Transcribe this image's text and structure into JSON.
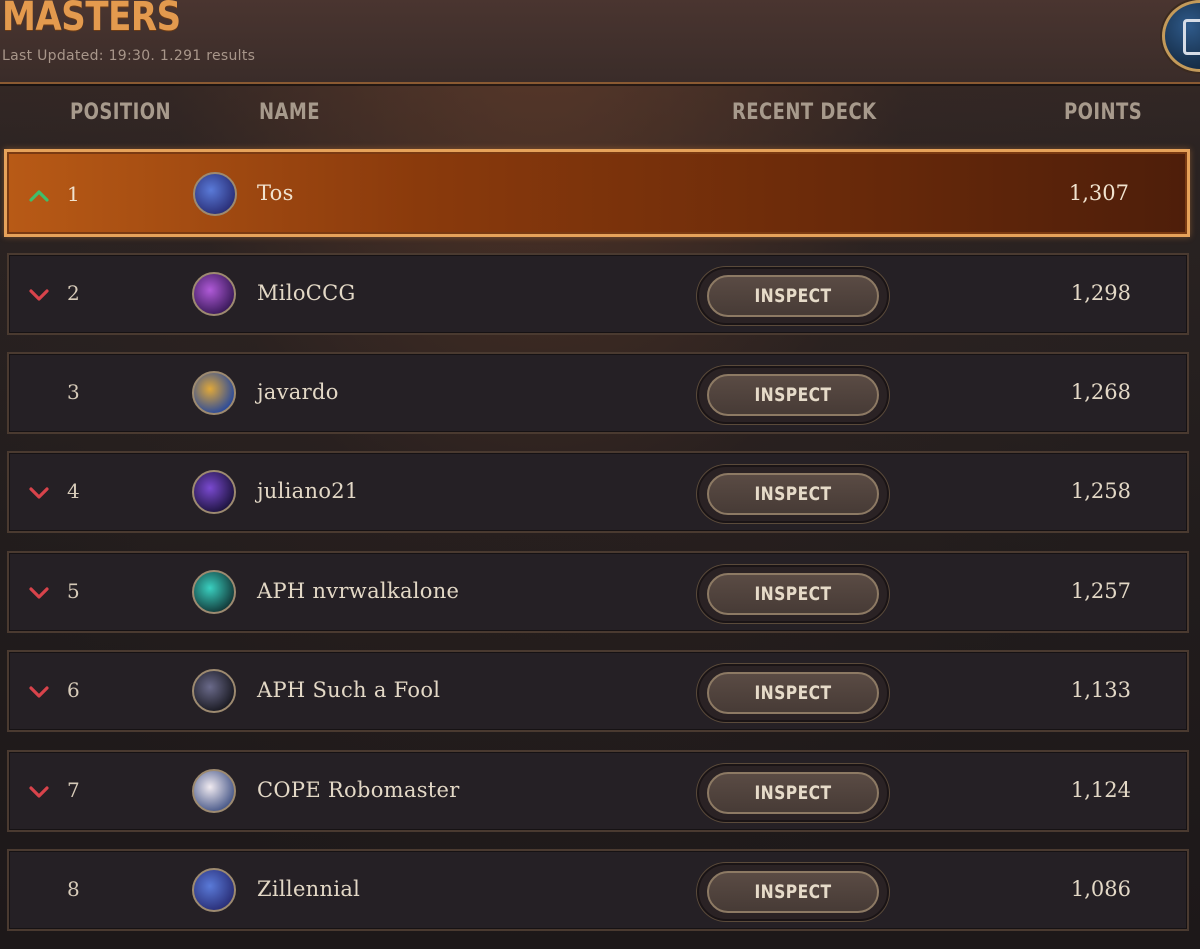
{
  "header": {
    "title": "MASTERS",
    "subtitle": "Last Updated: 19:30. 1.291 results"
  },
  "columns": {
    "position": "POSITION",
    "name": "NAME",
    "recent_deck": "RECENT DECK",
    "points": "POINTS"
  },
  "colors": {
    "accent": "#e39a4e",
    "trend_up": "#3fbf6a",
    "trend_down": "#d8434b",
    "highlight_row": "#a84e12"
  },
  "rows": [
    {
      "position": "1",
      "name": "Tos",
      "points": "1,307",
      "trend": "up",
      "avatar": "purple-ghost-avatar",
      "inspect_label": ""
    },
    {
      "position": "2",
      "name": "MiloCCG",
      "points": "1,298",
      "trend": "down",
      "avatar": "purple-gem-avatar",
      "inspect_label": "INSPECT"
    },
    {
      "position": "3",
      "name": "javardo",
      "points": "1,268",
      "trend": "none",
      "avatar": "card-avatar",
      "inspect_label": "INSPECT"
    },
    {
      "position": "4",
      "name": "juliano21",
      "points": "1,258",
      "trend": "down",
      "avatar": "purple-dragon-avatar",
      "inspect_label": "INSPECT"
    },
    {
      "position": "5",
      "name": "APH nvrwalkalone",
      "points": "1,257",
      "trend": "down",
      "avatar": "teal-spirit-avatar",
      "inspect_label": "INSPECT"
    },
    {
      "position": "6",
      "name": "APH Such a Fool",
      "points": "1,133",
      "trend": "down",
      "avatar": "dark-creature-avatar",
      "inspect_label": "INSPECT"
    },
    {
      "position": "7",
      "name": "COPE Robomaster",
      "points": "1,124",
      "trend": "down",
      "avatar": "white-fox-avatar",
      "inspect_label": "INSPECT"
    },
    {
      "position": "8",
      "name": "Zillennial",
      "points": "1,086",
      "trend": "none",
      "avatar": "purple-ghost-avatar",
      "inspect_label": "INSPECT"
    }
  ]
}
